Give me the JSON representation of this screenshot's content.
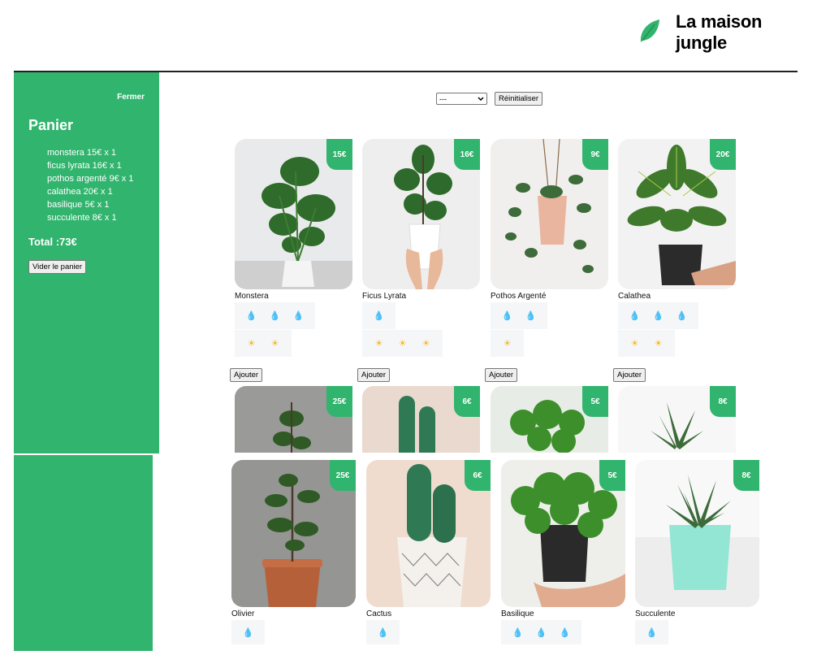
{
  "header": {
    "title": "La maison jungle",
    "logo_icon": "leaf-icon"
  },
  "cart": {
    "close_label": "Fermer",
    "title": "Panier",
    "items": [
      "monstera 15€ x 1",
      "ficus lyrata 16€ x 1",
      "pothos argenté 9€ x 1",
      "calathea 20€ x 1",
      "basilique 5€ x 1",
      "succulente 8€ x 1"
    ],
    "total": "Total :73€",
    "empty_label": "Vider le panier"
  },
  "filters": {
    "select_value": "---",
    "reset_label": "Réinitialiser"
  },
  "add_label": "Ajouter",
  "plants": [
    {
      "name": "Monstera",
      "price": "15€",
      "water": 3,
      "light": 2
    },
    {
      "name": "Ficus Lyrata",
      "price": "16€",
      "water": 1,
      "light": 3
    },
    {
      "name": "Pothos Argenté",
      "price": "9€",
      "water": 2,
      "light": 1
    },
    {
      "name": "Calathea",
      "price": "20€",
      "water": 3,
      "light": 2
    },
    {
      "name": "Olivier",
      "price": "25€",
      "water": 1
    },
    {
      "name": "Cactus",
      "price": "6€",
      "water": 1
    },
    {
      "name": "Basilique",
      "price": "5€",
      "water": 3
    },
    {
      "name": "Succulente",
      "price": "8€",
      "water": 1
    }
  ],
  "ghost_prices": [
    "25€",
    "6€",
    "5€",
    "8€"
  ],
  "colors": {
    "accent": "#31b46d",
    "water": "#3b8ed8",
    "sun": "#f2b51b"
  }
}
